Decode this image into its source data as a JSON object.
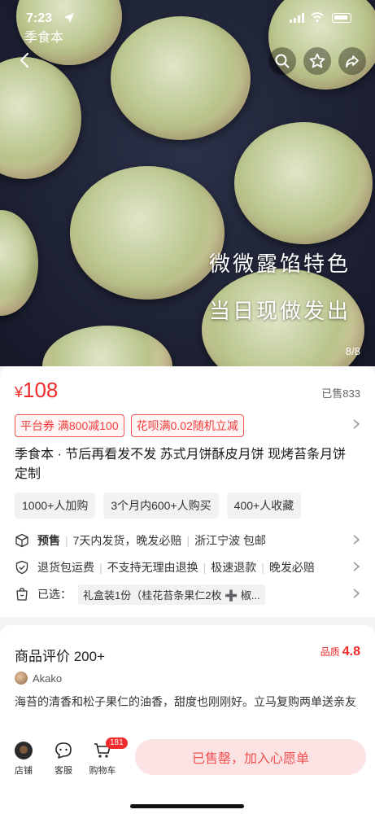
{
  "status_bar": {
    "time": "7:23",
    "back_app": "季食本"
  },
  "hero": {
    "overlay_line1": "微微露馅特色",
    "overlay_line2": "当日现做发出",
    "page_indicator": "8/8"
  },
  "product": {
    "currency": "¥",
    "price": "108",
    "sold": "已售833",
    "coupons": [
      "平台券 满800减100",
      "花呗满0.02随机立减"
    ],
    "title": "季食本 · 节后再看发不发 苏式月饼酥皮月饼 现烤苔条月饼 定制",
    "tags": [
      "1000+人加购",
      "3个月内600+人购买",
      "400+人收藏"
    ],
    "shipping": {
      "presale_label": "预售",
      "items": [
        "7天内发货，晚发必赔",
        "浙江宁波 包邮"
      ]
    },
    "service": {
      "items": [
        "退货包运费",
        "不支持无理由退换",
        "极速退款",
        "晚发必赔"
      ]
    },
    "selection": {
      "label": "已选：",
      "value": "礼盒装1份（桂花苔条果仁2枚 ➕ 椒..."
    }
  },
  "reviews": {
    "title": "商品评价 200+",
    "quality_label": "品质",
    "quality_score": "4.8",
    "first_review": {
      "user": "Akako",
      "text": "海苔的清香和松子果仁的油香，甜度也刚刚好。立马复购两单送亲友"
    }
  },
  "bottom_bar": {
    "shop_label": "店铺",
    "service_label": "客服",
    "cart_label": "购物车",
    "cart_count": "181",
    "cta_label": "已售罄，加入心愿单"
  },
  "colors": {
    "accent": "#f02b2b",
    "cta_bg": "#fbe3e3",
    "hero_bg": "#1c2032"
  }
}
